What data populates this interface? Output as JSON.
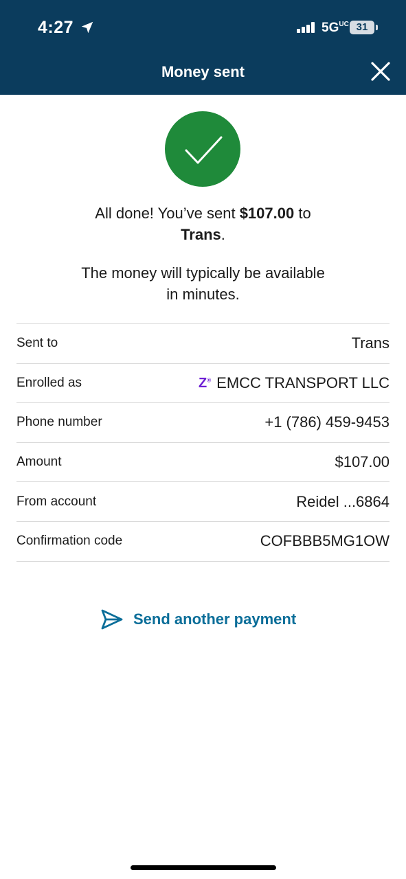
{
  "status_bar": {
    "time": "4:27",
    "network": "5G",
    "network_sup": "UC",
    "battery": "31",
    "location_icon": "location-arrow-icon",
    "signal_icon": "signal-bars-icon"
  },
  "header": {
    "title": "Money sent",
    "close_icon": "close-icon",
    "background": "#0b3c5d"
  },
  "success": {
    "icon": "checkmark-icon",
    "color": "#1f8a3a",
    "line1_prefix": "All done! You’ve sent ",
    "amount": "$107.00",
    "line1_mid": " to",
    "recipient": "Trans",
    "line2_suffix": ".",
    "availability_line1": "The money will typically be available",
    "availability_line2": "in minutes."
  },
  "details": [
    {
      "label": "Sent to",
      "value": "Trans"
    },
    {
      "label": "Enrolled as",
      "value": "EMCC TRANSPORT LLC",
      "badge": "Z",
      "badge_sup": "®"
    },
    {
      "label": "Phone number",
      "value": "+1 (786) 459-9453"
    },
    {
      "label": "Amount",
      "value": "$107.00"
    },
    {
      "label": "From account",
      "value": "Reidel ...6864"
    },
    {
      "label": "Confirmation code",
      "value": "COFBBB5MG1OW"
    }
  ],
  "actions": {
    "send_another": "Send another payment",
    "send_icon": "paper-plane-icon",
    "accent": "#0b6e99"
  }
}
